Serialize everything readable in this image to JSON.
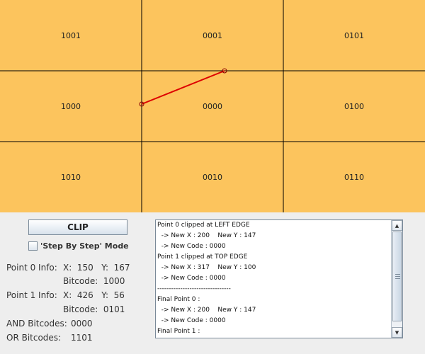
{
  "canvas": {
    "background": "#fcc45d",
    "region_codes": [
      "1001",
      "0001",
      "0101",
      "1000",
      "0000",
      "0100",
      "1010",
      "0010",
      "0110"
    ],
    "clip_line_color": "#dd0000"
  },
  "controls": {
    "clip_label": "CLIP",
    "step_mode_label": "'Step By Step' Mode",
    "step_mode_checked": false
  },
  "info": {
    "point0_label": "Point 0 Info:",
    "point0_coords": "X:  150   Y:  167",
    "point0_bitcode": "Bitcode:  1000",
    "point1_label": "Point 1 Info:",
    "point1_coords": "X:  426   Y:  56",
    "point1_bitcode": "Bitcode:  0101",
    "and_label": "AND Bitcodes:",
    "and_value": "0000",
    "or_label": "OR Bitcodes:",
    "or_value": "1101"
  },
  "log": {
    "lines": [
      "Point 0 clipped at LEFT EDGE",
      "  -> New X : 200    New Y : 147",
      "  -> New Code : 0000",
      "Point 1 clipped at TOP EDGE",
      "  -> New X : 317    New Y : 100",
      "  -> New Code : 0000",
      "--------------------------------",
      "Final Point 0 :",
      "  -> New X : 200    New Y : 147",
      "  -> New Code : 0000",
      "Final Point 1 :"
    ]
  }
}
